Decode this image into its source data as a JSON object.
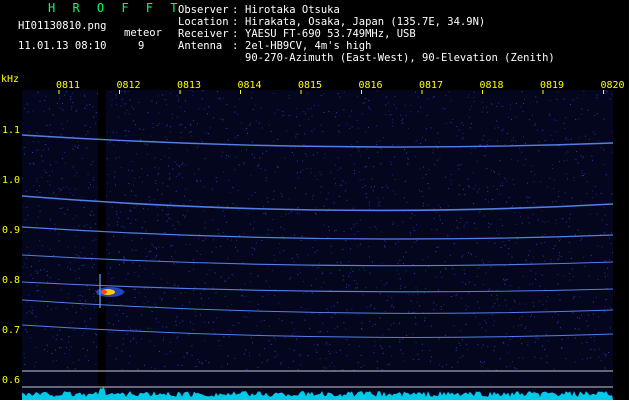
{
  "title": "H R O F F T",
  "file": {
    "name": "HI01130810.png",
    "datetime": "11.01.13 08:10",
    "type_label": "meteor",
    "count": "9"
  },
  "info": {
    "observer_label": "Observer",
    "observer": "Hirotaka Otsuka",
    "location_label": "Location",
    "location": "Hirakata, Osaka, Japan (135.7E, 34.9N)",
    "receiver_label": "Receiver",
    "receiver": "YAESU FT-690 53.749MHz, USB",
    "antenna_label": "Antenna",
    "antenna": "2el-HB9CV, 4m's high",
    "antenna_line2": "90-270-Azimuth (East-West), 90-Elevation (Zenith)"
  },
  "axis": {
    "unit": "kHz",
    "y_ticks": [
      "1.1",
      "1.0",
      "0.9",
      "0.8",
      "0.7",
      "0.6"
    ],
    "x_ticks": [
      "0811",
      "0812",
      "0813",
      "0814",
      "0815",
      "0816",
      "0817",
      "0818",
      "0819",
      "0820"
    ]
  },
  "colors": {
    "text": "#ffffff",
    "axis": "#ffff00",
    "title": "#00ff66",
    "signal": "#5a8cff",
    "noise": "#00e0ff",
    "meteor": "#ff4020"
  }
}
